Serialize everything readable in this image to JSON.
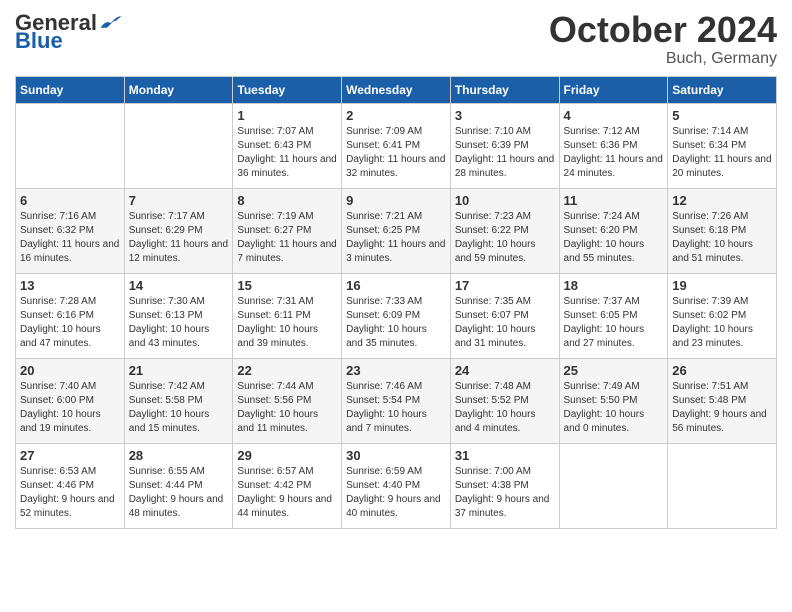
{
  "header": {
    "logo_general": "General",
    "logo_blue": "Blue",
    "title": "October 2024",
    "location": "Buch, Germany"
  },
  "weekdays": [
    "Sunday",
    "Monday",
    "Tuesday",
    "Wednesday",
    "Thursday",
    "Friday",
    "Saturday"
  ],
  "weeks": [
    [
      {
        "day": "",
        "sunrise": "",
        "sunset": "",
        "daylight": ""
      },
      {
        "day": "",
        "sunrise": "",
        "sunset": "",
        "daylight": ""
      },
      {
        "day": "1",
        "sunrise": "Sunrise: 7:07 AM",
        "sunset": "Sunset: 6:43 PM",
        "daylight": "Daylight: 11 hours and 36 minutes."
      },
      {
        "day": "2",
        "sunrise": "Sunrise: 7:09 AM",
        "sunset": "Sunset: 6:41 PM",
        "daylight": "Daylight: 11 hours and 32 minutes."
      },
      {
        "day": "3",
        "sunrise": "Sunrise: 7:10 AM",
        "sunset": "Sunset: 6:39 PM",
        "daylight": "Daylight: 11 hours and 28 minutes."
      },
      {
        "day": "4",
        "sunrise": "Sunrise: 7:12 AM",
        "sunset": "Sunset: 6:36 PM",
        "daylight": "Daylight: 11 hours and 24 minutes."
      },
      {
        "day": "5",
        "sunrise": "Sunrise: 7:14 AM",
        "sunset": "Sunset: 6:34 PM",
        "daylight": "Daylight: 11 hours and 20 minutes."
      }
    ],
    [
      {
        "day": "6",
        "sunrise": "Sunrise: 7:16 AM",
        "sunset": "Sunset: 6:32 PM",
        "daylight": "Daylight: 11 hours and 16 minutes."
      },
      {
        "day": "7",
        "sunrise": "Sunrise: 7:17 AM",
        "sunset": "Sunset: 6:29 PM",
        "daylight": "Daylight: 11 hours and 12 minutes."
      },
      {
        "day": "8",
        "sunrise": "Sunrise: 7:19 AM",
        "sunset": "Sunset: 6:27 PM",
        "daylight": "Daylight: 11 hours and 7 minutes."
      },
      {
        "day": "9",
        "sunrise": "Sunrise: 7:21 AM",
        "sunset": "Sunset: 6:25 PM",
        "daylight": "Daylight: 11 hours and 3 minutes."
      },
      {
        "day": "10",
        "sunrise": "Sunrise: 7:23 AM",
        "sunset": "Sunset: 6:22 PM",
        "daylight": "Daylight: 10 hours and 59 minutes."
      },
      {
        "day": "11",
        "sunrise": "Sunrise: 7:24 AM",
        "sunset": "Sunset: 6:20 PM",
        "daylight": "Daylight: 10 hours and 55 minutes."
      },
      {
        "day": "12",
        "sunrise": "Sunrise: 7:26 AM",
        "sunset": "Sunset: 6:18 PM",
        "daylight": "Daylight: 10 hours and 51 minutes."
      }
    ],
    [
      {
        "day": "13",
        "sunrise": "Sunrise: 7:28 AM",
        "sunset": "Sunset: 6:16 PM",
        "daylight": "Daylight: 10 hours and 47 minutes."
      },
      {
        "day": "14",
        "sunrise": "Sunrise: 7:30 AM",
        "sunset": "Sunset: 6:13 PM",
        "daylight": "Daylight: 10 hours and 43 minutes."
      },
      {
        "day": "15",
        "sunrise": "Sunrise: 7:31 AM",
        "sunset": "Sunset: 6:11 PM",
        "daylight": "Daylight: 10 hours and 39 minutes."
      },
      {
        "day": "16",
        "sunrise": "Sunrise: 7:33 AM",
        "sunset": "Sunset: 6:09 PM",
        "daylight": "Daylight: 10 hours and 35 minutes."
      },
      {
        "day": "17",
        "sunrise": "Sunrise: 7:35 AM",
        "sunset": "Sunset: 6:07 PM",
        "daylight": "Daylight: 10 hours and 31 minutes."
      },
      {
        "day": "18",
        "sunrise": "Sunrise: 7:37 AM",
        "sunset": "Sunset: 6:05 PM",
        "daylight": "Daylight: 10 hours and 27 minutes."
      },
      {
        "day": "19",
        "sunrise": "Sunrise: 7:39 AM",
        "sunset": "Sunset: 6:02 PM",
        "daylight": "Daylight: 10 hours and 23 minutes."
      }
    ],
    [
      {
        "day": "20",
        "sunrise": "Sunrise: 7:40 AM",
        "sunset": "Sunset: 6:00 PM",
        "daylight": "Daylight: 10 hours and 19 minutes."
      },
      {
        "day": "21",
        "sunrise": "Sunrise: 7:42 AM",
        "sunset": "Sunset: 5:58 PM",
        "daylight": "Daylight: 10 hours and 15 minutes."
      },
      {
        "day": "22",
        "sunrise": "Sunrise: 7:44 AM",
        "sunset": "Sunset: 5:56 PM",
        "daylight": "Daylight: 10 hours and 11 minutes."
      },
      {
        "day": "23",
        "sunrise": "Sunrise: 7:46 AM",
        "sunset": "Sunset: 5:54 PM",
        "daylight": "Daylight: 10 hours and 7 minutes."
      },
      {
        "day": "24",
        "sunrise": "Sunrise: 7:48 AM",
        "sunset": "Sunset: 5:52 PM",
        "daylight": "Daylight: 10 hours and 4 minutes."
      },
      {
        "day": "25",
        "sunrise": "Sunrise: 7:49 AM",
        "sunset": "Sunset: 5:50 PM",
        "daylight": "Daylight: 10 hours and 0 minutes."
      },
      {
        "day": "26",
        "sunrise": "Sunrise: 7:51 AM",
        "sunset": "Sunset: 5:48 PM",
        "daylight": "Daylight: 9 hours and 56 minutes."
      }
    ],
    [
      {
        "day": "27",
        "sunrise": "Sunrise: 6:53 AM",
        "sunset": "Sunset: 4:46 PM",
        "daylight": "Daylight: 9 hours and 52 minutes."
      },
      {
        "day": "28",
        "sunrise": "Sunrise: 6:55 AM",
        "sunset": "Sunset: 4:44 PM",
        "daylight": "Daylight: 9 hours and 48 minutes."
      },
      {
        "day": "29",
        "sunrise": "Sunrise: 6:57 AM",
        "sunset": "Sunset: 4:42 PM",
        "daylight": "Daylight: 9 hours and 44 minutes."
      },
      {
        "day": "30",
        "sunrise": "Sunrise: 6:59 AM",
        "sunset": "Sunset: 4:40 PM",
        "daylight": "Daylight: 9 hours and 40 minutes."
      },
      {
        "day": "31",
        "sunrise": "Sunrise: 7:00 AM",
        "sunset": "Sunset: 4:38 PM",
        "daylight": "Daylight: 9 hours and 37 minutes."
      },
      {
        "day": "",
        "sunrise": "",
        "sunset": "",
        "daylight": ""
      },
      {
        "day": "",
        "sunrise": "",
        "sunset": "",
        "daylight": ""
      }
    ]
  ]
}
